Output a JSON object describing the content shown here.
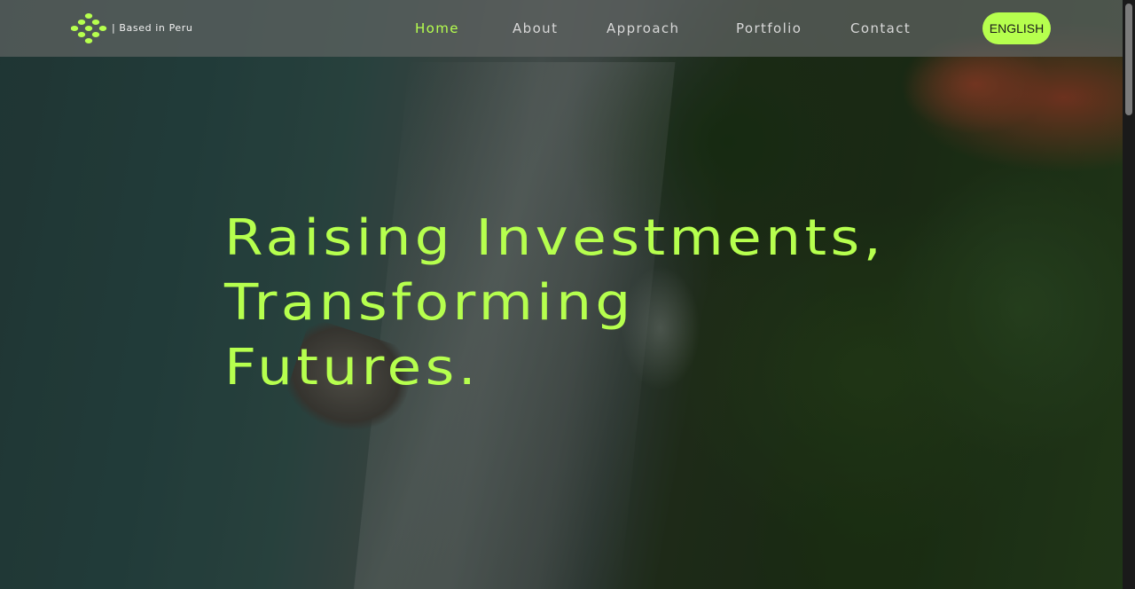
{
  "brand": {
    "tagline": "| Based in Peru",
    "icon": "dotted-diamond-logo",
    "accent_color": "#b6ff4e"
  },
  "nav": {
    "items": [
      {
        "label": "Home",
        "active": true
      },
      {
        "label": "About",
        "active": false
      },
      {
        "label": "Approach",
        "active": false
      },
      {
        "label": "Portfolio",
        "active": false
      },
      {
        "label": "Contact",
        "active": false
      }
    ],
    "language_button": "ENGLISH"
  },
  "hero": {
    "lines": [
      "Raising Investments,",
      "Transforming",
      "Futures."
    ]
  }
}
